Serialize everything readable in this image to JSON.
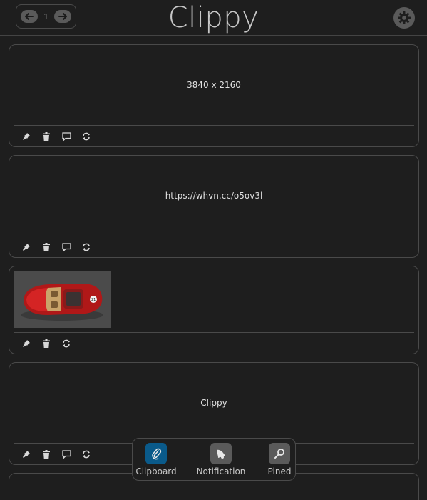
{
  "header": {
    "title": "Clippy",
    "page": "1",
    "prev_icon": "arrow-left-icon",
    "next_icon": "arrow-right-icon",
    "settings_icon": "gear-icon"
  },
  "clips": [
    {
      "type": "text",
      "content": "3840 x 2160",
      "actions": [
        "pin",
        "delete",
        "comment",
        "sync"
      ]
    },
    {
      "type": "text",
      "content": "https://whvn.cc/o5ov3l",
      "actions": [
        "pin",
        "delete",
        "comment",
        "sync"
      ]
    },
    {
      "type": "image",
      "content": "",
      "actions": [
        "pin",
        "delete",
        "sync"
      ]
    },
    {
      "type": "text",
      "content": "Clippy",
      "actions": [
        "pin",
        "delete",
        "comment",
        "sync"
      ]
    }
  ],
  "bottom_nav": {
    "items": [
      {
        "label": "Clipboard",
        "icon": "paperclip-icon",
        "active": true
      },
      {
        "label": "Notification",
        "icon": "bell-icon",
        "active": false
      },
      {
        "label": "Pined",
        "icon": "pin-icon",
        "active": false
      }
    ]
  },
  "colors": {
    "background": "#1e1e1e",
    "border": "#4a4a4a",
    "active_nav": "#0a5a8a",
    "icon_bg": "#5a5a5a"
  }
}
